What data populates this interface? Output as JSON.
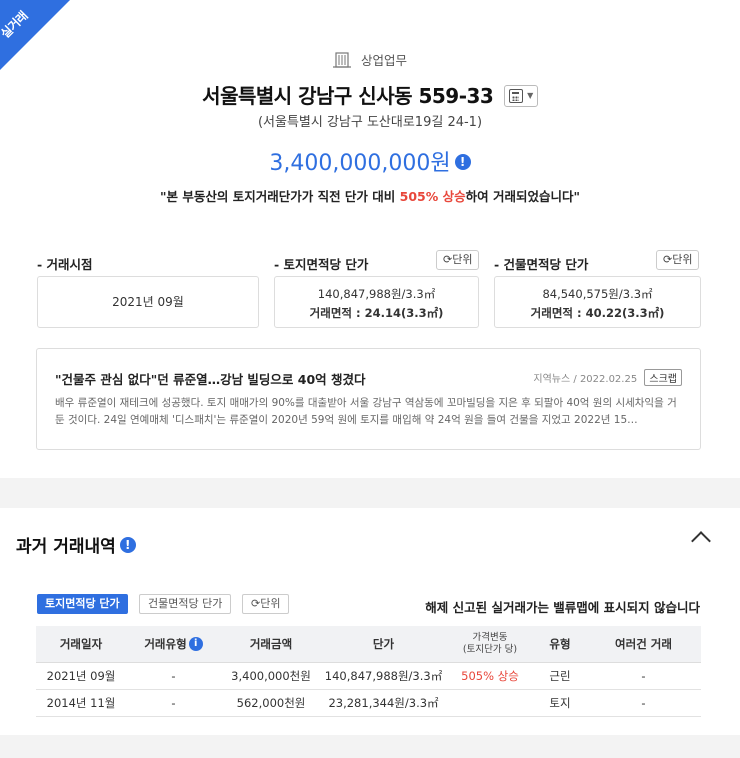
{
  "ribbon": {
    "label": "실거래"
  },
  "property": {
    "type": "상업업무",
    "address": "서울특별시 강남구 신사동 559-33",
    "road_address": "(서울특별시 강남구 도산대로19길 24-1)",
    "price": "3,400,000,000원",
    "desc_prefix": "\"본 부동산의 토지거래단가가 직전 단가 대비 ",
    "desc_highlight": "505% 상승",
    "desc_suffix": "하여 거래되었습니다\""
  },
  "summary": {
    "deal_date_label": "- 거래시점",
    "deal_date_value": "2021년 09월",
    "land_label": "- 토지면적당 단가",
    "land_unit_btn": "단위",
    "land_price": "140,847,988원/3.3㎡",
    "land_area": "거래면적 : 24.14(3.3㎡)",
    "bldg_label": "- 건물면적당 단가",
    "bldg_unit_btn": "단위",
    "bldg_price": "84,540,575원/3.3㎡",
    "bldg_area": "거래면적 : 40.22(3.3㎡)"
  },
  "news": {
    "title": "\"건물주 관심 없다\"던 류준열…강남 빌딩으로 40억 챙겼다",
    "source": "지역뉴스",
    "date": "2022.02.25",
    "scrap": "스크랩",
    "body": "배우 류준열이 재테크에 성공했다. 토지 매매가의 90%를 대출받아 서울 강남구 역삼동에 꼬마빌딩을 지은 후 되팔아 40억 원의 시세차익을 거둔 것이다. 24일 연예매체 '디스패치'는 류준열이 2020년 59억 원에 토지를 매입해 약 24억 원을 들여 건물을 지었고 2022년 15…"
  },
  "history": {
    "title": "과거 거래내역",
    "tab_land": "토지면적당 단가",
    "tab_bldg": "건물면적당 단가",
    "unit_btn": "단위",
    "notice": "해제 신고된 실거래가는 밸류맵에 표시되지 않습니다",
    "columns": [
      "거래일자",
      "거래유형",
      "거래금액",
      "단가",
      "가격변동",
      "(토지단가 당)",
      "유형",
      "여러건 거래"
    ],
    "rows": [
      [
        "2021년 09월",
        "-",
        "3,400,000천원",
        "140,847,988원/3.3㎡",
        "505% 상승",
        "근린",
        "-"
      ],
      [
        "2014년 11월",
        "-",
        "562,000천원",
        "23,281,344원/3.3㎡",
        "",
        "토지",
        "-"
      ]
    ]
  },
  "colors": {
    "accent": "#2f6fe0",
    "up": "#e8473b"
  },
  "icons": {
    "building": "building-icon",
    "calculator": "calculator-icon",
    "info": "info-icon",
    "refresh": "refresh-icon",
    "chevron": "chevron-up-icon"
  }
}
